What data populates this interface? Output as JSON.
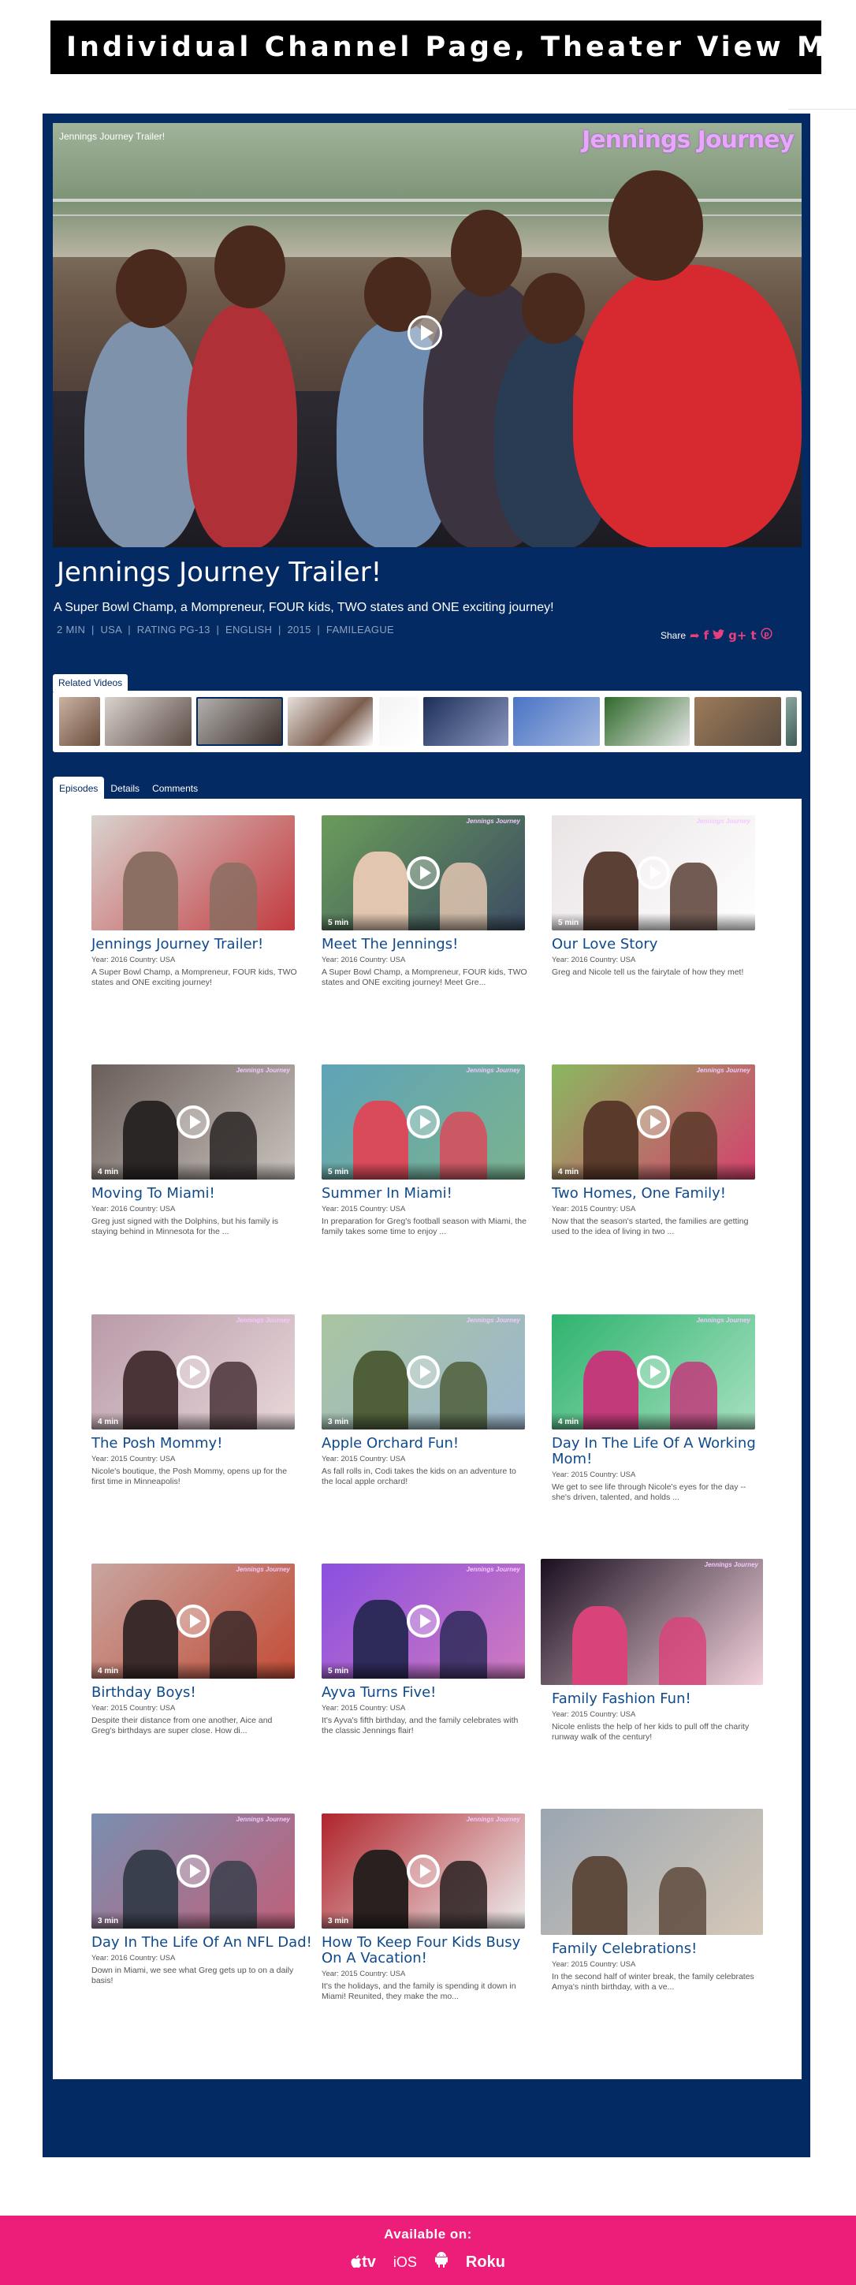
{
  "banner": {
    "title": "Individual Channel Page, Theater View Mode"
  },
  "player": {
    "overlay_title": "Jennings Journey Trailer!",
    "logo": "Jennings Journey",
    "play_icon": "play-circle-icon"
  },
  "video": {
    "title": "Jennings Journey Trailer!",
    "tagline": "A Super Bowl Champ, a Mompreneur, FOUR kids, TWO states and ONE exciting journey!",
    "meta": "2 MIN  |  USA  |  RATING PG-13  |  ENGLISH  |  2015  |  FAMILEAGUE"
  },
  "share": {
    "label": "Share",
    "icons": [
      "share-arrow-icon",
      "facebook-icon",
      "twitter-icon",
      "google-plus-icon",
      "tumblr-icon",
      "pinterest-icon"
    ],
    "glyphs": [
      "➦",
      "f",
      "🐦",
      "g+",
      "t",
      "℗"
    ]
  },
  "related": {
    "label": "Related Videos",
    "count": 10
  },
  "tabs": [
    {
      "label": "Episodes",
      "active": true
    },
    {
      "label": "Details",
      "active": false
    },
    {
      "label": "Comments",
      "active": false
    }
  ],
  "episodes": [
    {
      "title": "Jennings Journey Trailer!",
      "meta": "Year: 2016 Country: USA",
      "desc": "A Super Bowl Champ, a Mompreneur, FOUR kids, TWO states and ONE exciting journey!",
      "duration": "",
      "play": false,
      "logo": ""
    },
    {
      "title": "Meet The Jennings!",
      "meta": "Year: 2016 Country: USA",
      "desc": "A Super Bowl Champ, a Mompreneur, FOUR kids, TWO states and ONE exciting journey! Meet Gre...",
      "duration": "5 min",
      "play": true,
      "logo": "Jennings Journey"
    },
    {
      "title": "Our Love Story",
      "meta": "Year: 2016 Country: USA",
      "desc": "Greg and Nicole tell us the fairytale of how they met!",
      "duration": "5 min",
      "play": true,
      "logo": "Jennings Journey"
    },
    {
      "title": "Moving To Miami!",
      "meta": "Year: 2016 Country: USA",
      "desc": "Greg just signed with the Dolphins, but his family is staying behind in Minnesota for the ...",
      "duration": "4 min",
      "play": true,
      "logo": "Jennings Journey"
    },
    {
      "title": "Summer In Miami!",
      "meta": "Year: 2015 Country: USA",
      "desc": "In preparation for Greg's football season with Miami, the family takes some time to enjoy ...",
      "duration": "5 min",
      "play": true,
      "logo": "Jennings Journey"
    },
    {
      "title": "Two Homes, One Family!",
      "meta": "Year: 2015 Country: USA",
      "desc": "Now that the season's started, the families are getting used to the idea of living in two ...",
      "duration": "4 min",
      "play": true,
      "logo": "Jennings Journey"
    },
    {
      "title": "The Posh Mommy!",
      "meta": "Year: 2015 Country: USA",
      "desc": "Nicole's boutique, the Posh Mommy, opens up for the first time in Minneapolis!",
      "duration": "4 min",
      "play": true,
      "logo": "Jennings Journey"
    },
    {
      "title": "Apple Orchard Fun!",
      "meta": "Year: 2015 Country: USA",
      "desc": "As fall rolls in, Codi takes the kids on an adventure to the local apple orchard!",
      "duration": "3 min",
      "play": true,
      "logo": "Jennings Journey"
    },
    {
      "title": "Day In The Life Of A Working Mom!",
      "meta": "Year: 2015 Country: USA",
      "desc": "We get to see life through Nicole's eyes for the day -- she's driven, talented, and holds ...",
      "duration": "4 min",
      "play": true,
      "logo": "Jennings Journey"
    },
    {
      "title": "Birthday Boys!",
      "meta": "Year: 2015 Country: USA",
      "desc": "Despite their distance from one another, Aice and Greg's birthdays are super close. How di...",
      "duration": "4 min",
      "play": true,
      "logo": "Jennings Journey"
    },
    {
      "title": "Ayva Turns Five!",
      "meta": "Year: 2015 Country: USA",
      "desc": "It's Ayva's fifth birthday, and the family celebrates with the classic Jennings flair!",
      "duration": "5 min",
      "play": true,
      "logo": "Jennings Journey"
    },
    {
      "title": "Family Fashion Fun!",
      "meta": "Year: 2015 Country: USA",
      "desc": "Nicole enlists the help of her kids to pull off the charity runway walk of the century!",
      "duration": "",
      "play": false,
      "logo": "Jennings Journey"
    },
    {
      "title": "Day In The Life Of An NFL Dad!",
      "meta": "Year: 2016 Country: USA",
      "desc": "Down in Miami, we see what Greg gets up to on a daily basis!",
      "duration": "3 min",
      "play": true,
      "logo": "Jennings Journey"
    },
    {
      "title": "How To Keep Four Kids Busy On A Vacation!",
      "meta": "Year: 2015 Country: USA",
      "desc": "It's the holidays, and the family is spending it down in Miami! Reunited, they make the mo...",
      "duration": "3 min",
      "play": true,
      "logo": "Jennings Journey"
    },
    {
      "title": "Family Celebrations!",
      "meta": "Year: 2015 Country: USA",
      "desc": "In the second half of winter break, the family celebrates Amya's ninth birthday, with a ve...",
      "duration": "",
      "play": false,
      "logo": ""
    }
  ],
  "footer": {
    "label": "Available on:",
    "platforms": [
      {
        "name": "apple-tv-icon",
        "text": "tv"
      },
      {
        "name": "ios-icon",
        "text": "iOS"
      },
      {
        "name": "android-icon",
        "text": ""
      },
      {
        "name": "roku-icon",
        "text": "Roku"
      }
    ]
  }
}
